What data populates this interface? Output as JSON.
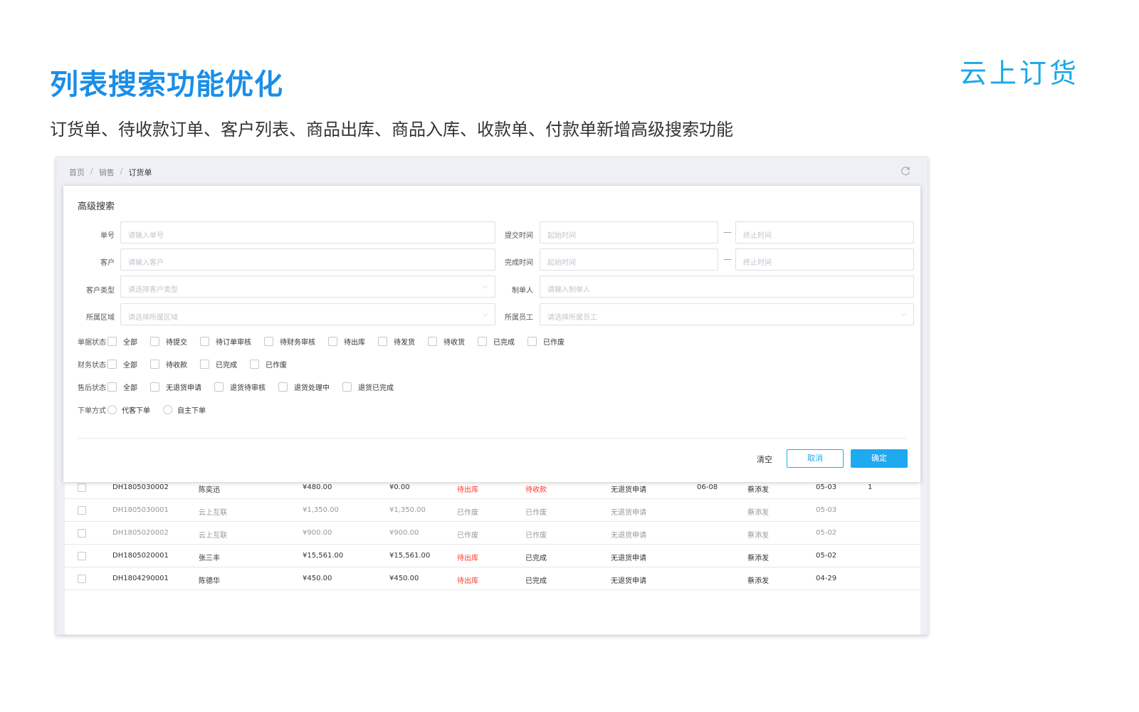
{
  "slide": {
    "title": "列表搜索功能优化",
    "subtitle": "订货单、待收款订单、客户列表、商品出库、商品入库、收款单、付款单新增高级搜索功能",
    "brand": "云上订货"
  },
  "breadcrumb": {
    "home": "首页",
    "sep": "/",
    "sales": "销售",
    "current": "订货单"
  },
  "modal": {
    "title": "高级搜索",
    "fields": {
      "order_no": {
        "label": "单号",
        "placeholder": "请输入单号"
      },
      "customer": {
        "label": "客户",
        "placeholder": "请输入客户"
      },
      "customer_type": {
        "label": "客户类型",
        "placeholder": "请选择客户类型"
      },
      "region": {
        "label": "所属区域",
        "placeholder": "请选择所属区域"
      },
      "submit_time": {
        "label": "提交时间",
        "start": "起始时间",
        "end": "终止时间"
      },
      "finish_time": {
        "label": "完成时间",
        "start": "起始时间",
        "end": "终止时间"
      },
      "creator": {
        "label": "制单人",
        "placeholder": "请输入制单人"
      },
      "staff": {
        "label": "所属员工",
        "placeholder": "请选择所属员工"
      },
      "range_sep": "—",
      "arrow": "⌵"
    },
    "doc_status": {
      "label": "单据状态",
      "options": [
        "全部",
        "待提交",
        "待订单审核",
        "待财务审核",
        "待出库",
        "待发货",
        "待收货",
        "已完成",
        "已作废"
      ]
    },
    "finance_status": {
      "label": "财务状态",
      "options": [
        "全部",
        "待收款",
        "已完成",
        "已作废"
      ]
    },
    "after_sale_status": {
      "label": "售后状态",
      "options": [
        "全部",
        "无退货申请",
        "退货待审核",
        "退货处理中",
        "退货已完成"
      ]
    },
    "order_method": {
      "label": "下单方式",
      "options": [
        "代客下单",
        "自主下单"
      ]
    },
    "buttons": {
      "clear": "清空",
      "cancel": "取消",
      "confirm": "确定"
    }
  },
  "table": {
    "rows": [
      {
        "no": "DH1805030002",
        "customer": "陈奕迅",
        "amount": "¥480.00",
        "paid": "¥0.00",
        "ship": "待出库",
        "pay": "待收款",
        "after": "无退货申请",
        "deliver": "06-08",
        "maker": "蔡添发",
        "date": "05-03",
        "extra": "1",
        "muted": false,
        "ship_red": true,
        "pay_red": true
      },
      {
        "no": "DH1805030001",
        "customer": "云上互联",
        "amount": "¥1,350.00",
        "paid": "¥1,350.00",
        "ship": "已作废",
        "pay": "已作废",
        "after": "无退货申请",
        "deliver": "",
        "maker": "蔡添发",
        "date": "05-03",
        "extra": "",
        "muted": true,
        "ship_red": false,
        "pay_red": false
      },
      {
        "no": "DH1805020002",
        "customer": "云上互联",
        "amount": "¥900.00",
        "paid": "¥900.00",
        "ship": "已作废",
        "pay": "已作废",
        "after": "无退货申请",
        "deliver": "",
        "maker": "蔡添发",
        "date": "05-02",
        "extra": "",
        "muted": true,
        "ship_red": false,
        "pay_red": false
      },
      {
        "no": "DH1805020001",
        "customer": "张三丰",
        "amount": "¥15,561.00",
        "paid": "¥15,561.00",
        "ship": "待出库",
        "pay": "已完成",
        "after": "无退货申请",
        "deliver": "",
        "maker": "蔡添发",
        "date": "05-02",
        "extra": "",
        "muted": false,
        "ship_red": true,
        "pay_red": false
      },
      {
        "no": "DH1804290001",
        "customer": "陈德华",
        "amount": "¥450.00",
        "paid": "¥450.00",
        "ship": "待出库",
        "pay": "已完成",
        "after": "无退货申请",
        "deliver": "",
        "maker": "蔡添发",
        "date": "04-29",
        "extra": "",
        "muted": false,
        "ship_red": true,
        "pay_red": false
      }
    ]
  }
}
